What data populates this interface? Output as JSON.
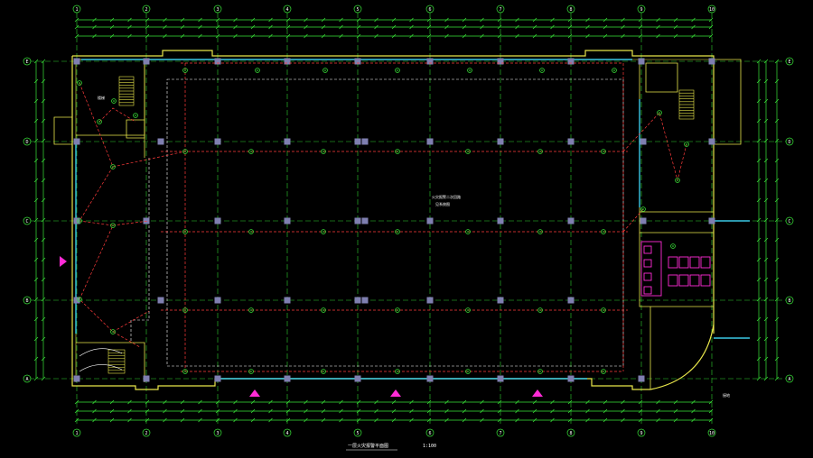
{
  "drawing": {
    "title": "一层火灾报警平面图",
    "scale": "1:100",
    "center_note_line1": "火灾报警二次回路",
    "center_note_line2": "见系统图",
    "stair_label": "楼梯",
    "corner_note": "接地",
    "line_color": "#ff3b3b",
    "wall_color": "#e8e64a",
    "dim_color": "#39e639",
    "column_color": "#7f7fb0",
    "glass_color": "#3ac9e6",
    "toilet_color": "#ff2bd6"
  },
  "grid_axes": {
    "top": [
      "1",
      "2",
      "3",
      "4",
      "5",
      "6",
      "7",
      "8",
      "9",
      "10"
    ],
    "left": [
      "E",
      "D",
      "C",
      "B",
      "A"
    ],
    "right": [
      "E",
      "D",
      "C",
      "B",
      "A"
    ]
  },
  "symbols": {
    "detector": "smoke-detector-icon",
    "entry_marker": "entrance-arrow-icon"
  }
}
